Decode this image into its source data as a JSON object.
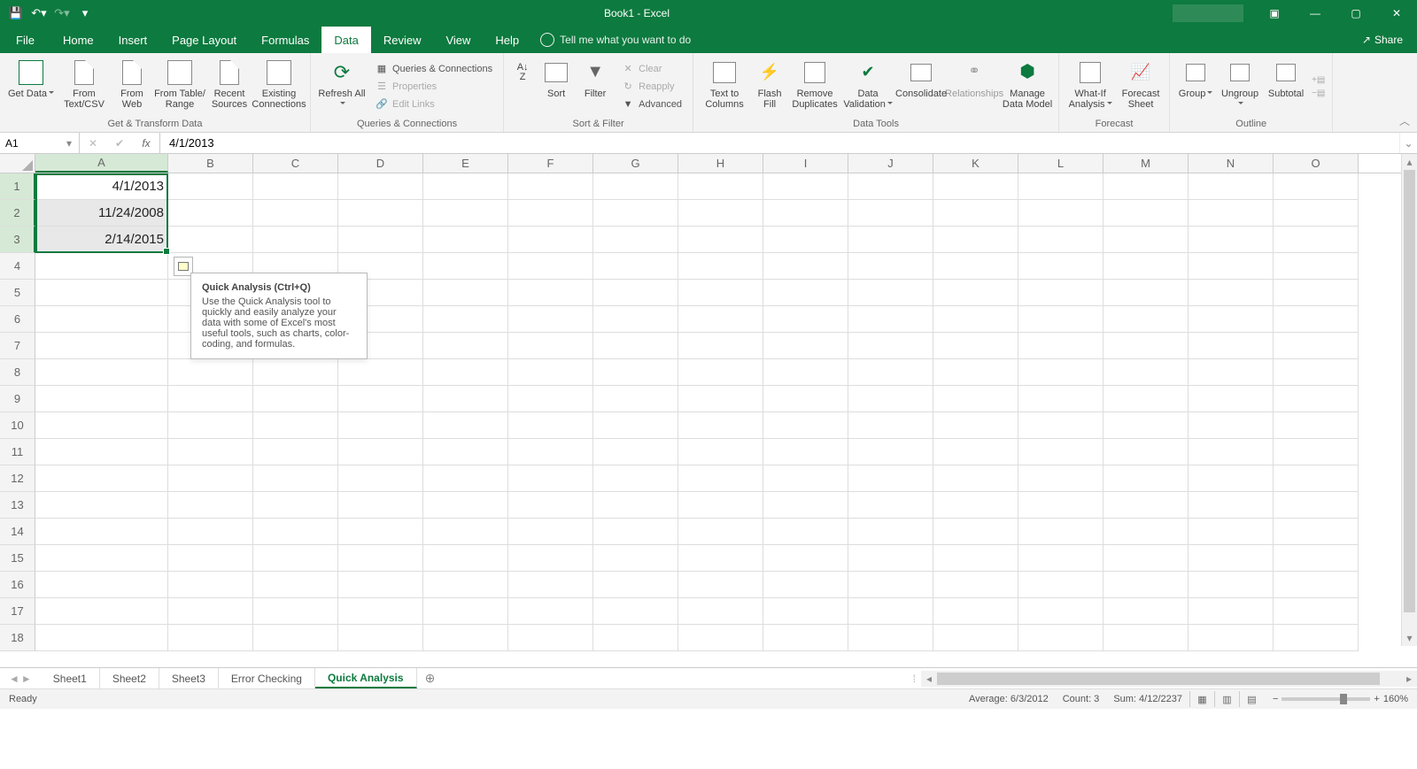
{
  "title": "Book1 - Excel",
  "qat": {
    "save": "Save",
    "undo": "Undo",
    "redo": "Redo"
  },
  "tabs": [
    "File",
    "Home",
    "Insert",
    "Page Layout",
    "Formulas",
    "Data",
    "Review",
    "View",
    "Help"
  ],
  "active_tab": "Data",
  "tellme": "Tell me what you want to do",
  "share": "Share",
  "ribbon": {
    "get_transform": {
      "label": "Get & Transform Data",
      "get_data": "Get Data",
      "from_textcsv": "From Text/CSV",
      "from_web": "From Web",
      "from_table": "From Table/ Range",
      "recent": "Recent Sources",
      "existing": "Existing Connections"
    },
    "queries": {
      "label": "Queries & Connections",
      "refresh": "Refresh All",
      "qc": "Queries & Connections",
      "props": "Properties",
      "edit_links": "Edit Links"
    },
    "sortfilter": {
      "label": "Sort & Filter",
      "sort": "Sort",
      "filter": "Filter",
      "clear": "Clear",
      "reapply": "Reapply",
      "advanced": "Advanced"
    },
    "datatools": {
      "label": "Data Tools",
      "ttc": "Text to Columns",
      "flash": "Flash Fill",
      "remdup": "Remove Duplicates",
      "valid": "Data Validation",
      "consol": "Consolidate",
      "rel": "Relationships",
      "mdm": "Manage Data Model"
    },
    "forecast": {
      "label": "Forecast",
      "whatif": "What-If Analysis",
      "fsheet": "Forecast Sheet"
    },
    "outline": {
      "label": "Outline",
      "group": "Group",
      "ungroup": "Ungroup",
      "subtotal": "Subtotal"
    }
  },
  "namebox": "A1",
  "formula": "4/1/2013",
  "columns": [
    "A",
    "B",
    "C",
    "D",
    "E",
    "F",
    "G",
    "H",
    "I",
    "J",
    "K",
    "L",
    "M",
    "N",
    "O"
  ],
  "rows_visible": 18,
  "cells": {
    "A1": "4/1/2013",
    "A2": "11/24/2008",
    "A3": "2/14/2015"
  },
  "tooltip": {
    "title": "Quick Analysis (Ctrl+Q)",
    "body": "Use the Quick Analysis tool to quickly and easily analyze your data with some of Excel's most useful tools, such as charts, color-coding, and formulas."
  },
  "sheet_tabs": [
    "Sheet1",
    "Sheet2",
    "Sheet3",
    "Error Checking",
    "Quick Analysis"
  ],
  "active_sheet": "Quick Analysis",
  "status": {
    "ready": "Ready",
    "average": "Average: 6/3/2012",
    "count": "Count: 3",
    "sum": "Sum: 4/12/2237",
    "zoom": "160%"
  }
}
